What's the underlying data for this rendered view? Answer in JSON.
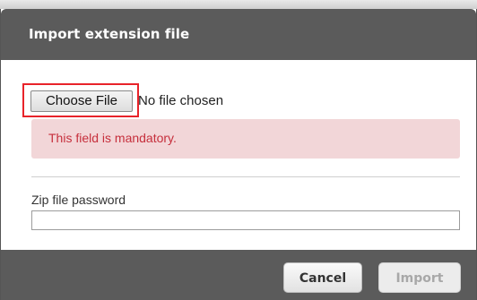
{
  "dialog": {
    "title": "Import extension file",
    "file_input": {
      "button_label": "Choose File",
      "status_text": "No file chosen"
    },
    "validation_error": "This field is mandatory.",
    "password": {
      "label": "Zip file password",
      "value": ""
    },
    "footer": {
      "cancel_label": "Cancel",
      "import_label": "Import",
      "import_enabled": false
    }
  },
  "colors": {
    "header_bg": "#5b5b5b",
    "error_bg": "#f2d6d8",
    "error_text": "#c62f3c",
    "highlight_border": "#e8232a"
  }
}
